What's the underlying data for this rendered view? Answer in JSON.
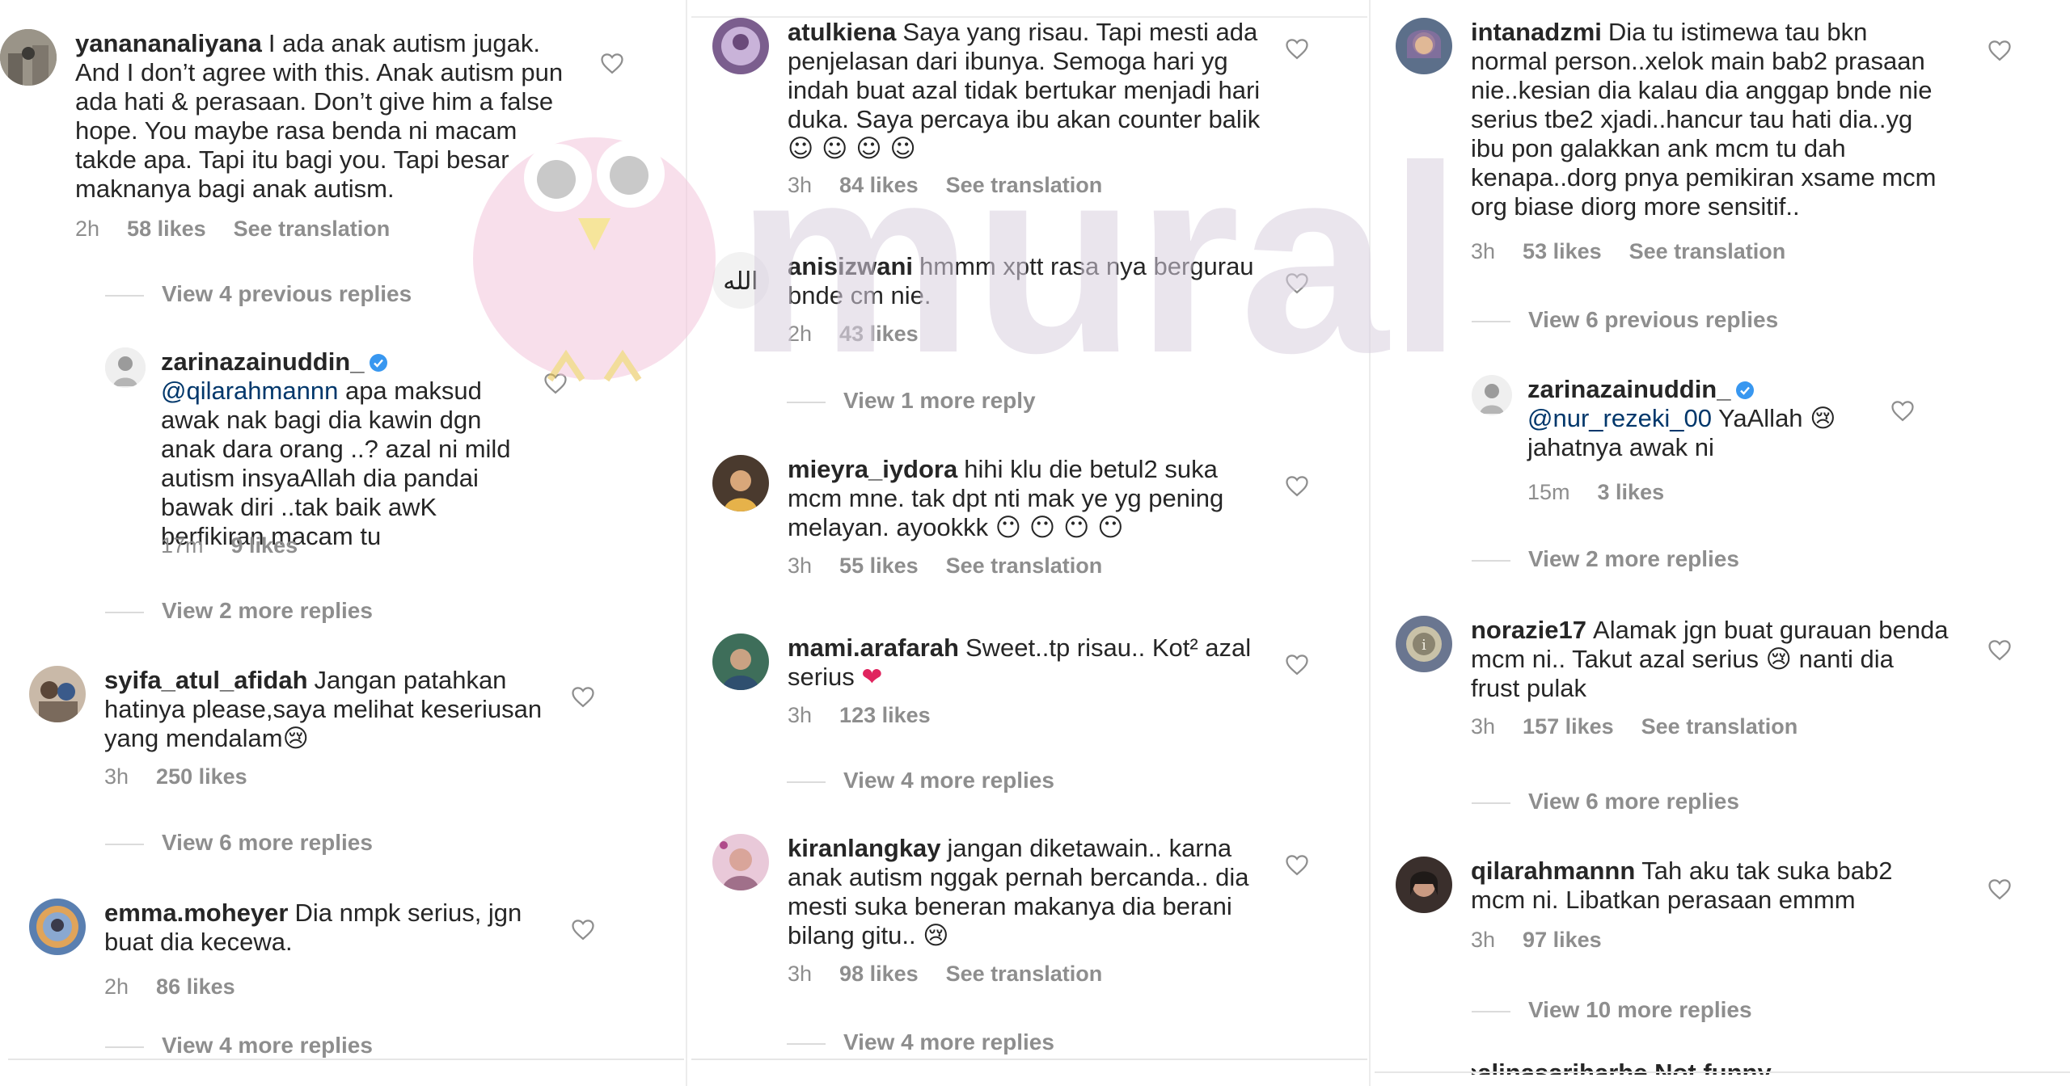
{
  "watermark": {
    "text": "mural"
  },
  "labels": {
    "see_translation": "See translation"
  },
  "columns": [
    {
      "items": [
        {
          "kind": "comment",
          "username": "yanananaliyana",
          "text": "I ada anak autism jugak. And I don’t agree with this. Anak autism pun ada hati & perasaan. Don’t give him a false hope. You maybe rasa benda ni macam takde apa. Tapi itu bagi you. Tapi besar maknanya bagi anak autism.",
          "time": "2h",
          "likes": "58 likes",
          "see_translation": true,
          "avatar": "#8a8478"
        },
        {
          "kind": "view",
          "text": "View 4 previous replies"
        },
        {
          "kind": "reply",
          "username": "zarinazainuddin_",
          "verified": true,
          "mention": "@qilarahmannn",
          "text": "apa maksud awak nak bagi dia kawin dgn anak dara orang ..? azal ni mild autism insyaAllah dia pandai bawak diri ..tak baik awK berfikiran macam tu",
          "time": "17m",
          "likes": "9 likes",
          "see_translation": false,
          "avatar": "#d9d9d9"
        },
        {
          "kind": "view",
          "text": "View 2 more replies"
        },
        {
          "kind": "comment",
          "username": "syifa_atul_afidah",
          "text": "Jangan patahkan hatinya please,saya melihat keseriusan yang mendalam",
          "emoji": "😢",
          "time": "3h",
          "likes": "250 likes",
          "see_translation": false,
          "avatar": "#7a6a5c"
        },
        {
          "kind": "view",
          "text": "View 6 more replies"
        },
        {
          "kind": "comment",
          "username": "emma.moheyer",
          "text": "Dia nmpk serius, jgn buat dia kecewa.",
          "time": "2h",
          "likes": "86 likes",
          "see_translation": false,
          "avatar": "#5a7fb0"
        },
        {
          "kind": "view",
          "text": "View 4 more replies"
        }
      ]
    },
    {
      "items": [
        {
          "kind": "comment",
          "username": "atulkiena",
          "text": "Saya yang risau. Tapi mesti ada penjelasan dari ibunya. Semoga hari yg indah buat azal tidak bertukar menjadi hari duka. Saya percaya ibu akan counter balik",
          "emoji": "☺ ☺ ☺ ☺",
          "time": "3h",
          "likes": "84 likes",
          "see_translation": true,
          "avatar": "#7b5e8e"
        },
        {
          "kind": "comment",
          "username": "anisizwani",
          "text": "hmmm xptt rasa nya bergurau bnde cm nie.",
          "time": "2h",
          "likes": "43 likes",
          "see_translation": false,
          "avatar": "#2b2b2b"
        },
        {
          "kind": "view",
          "text": "View 1 more reply"
        },
        {
          "kind": "comment",
          "username": "mieyra_iydora",
          "text": "hihi klu die betul2 suka mcm mne. tak dpt nti  mak ye yg pening melayan. ayookkk",
          "emoji": "😶 😶 😶 😶",
          "time": "3h",
          "likes": "55 likes",
          "see_translation": true,
          "avatar": "#4a3a2e"
        },
        {
          "kind": "comment",
          "username": "mami.arafarah",
          "text": "Sweet..tp risau.. Kot² azal serius",
          "emoji": "❤",
          "time": "3h",
          "likes": "123 likes",
          "see_translation": false,
          "avatar": "#3e6e5a"
        },
        {
          "kind": "view",
          "text": "View 4 more replies"
        },
        {
          "kind": "comment",
          "username": "kiranlangkay",
          "text": "jangan diketawain.. karna anak autism nggak pernah bercanda.. dia mesti suka beneran makanya dia berani bilang gitu..",
          "emoji": "😢",
          "time": "3h",
          "likes": "98 likes",
          "see_translation": true,
          "avatar": "#a0708a"
        },
        {
          "kind": "view",
          "text": "View 4 more replies"
        }
      ]
    },
    {
      "items": [
        {
          "kind": "comment",
          "username": "intanadzmi",
          "text": "Dia tu istimewa tau bkn normal person..xelok main bab2 prasaan nie..kesian dia kalau dia anggap bnde nie serius tbe2 xjadi..hancur tau hati dia..yg ibu pon galakkan ank mcm tu dah kenapa..dorg pnya pemikiran xsame mcm org biase diorg more sensitif..",
          "time": "3h",
          "likes": "53 likes",
          "see_translation": true,
          "avatar": "#5c6f8a"
        },
        {
          "kind": "view",
          "text": "View 6 previous replies"
        },
        {
          "kind": "reply",
          "username": "zarinazainuddin_",
          "verified": true,
          "mention": "@nur_rezeki_00",
          "text": "YaAllah",
          "emoji_after": "😢",
          "text2": "jahatnya awak ni",
          "time": "15m",
          "likes": "3 likes",
          "see_translation": false,
          "avatar": "#d9d9d9"
        },
        {
          "kind": "view",
          "text": "View 2 more replies"
        },
        {
          "kind": "comment",
          "username": "norazie17",
          "text": "Alamak jgn buat gurauan benda mcm ni.. Takut azal serius",
          "emoji_inline": "😢",
          "text_after": "nanti dia frust pulak",
          "time": "3h",
          "likes": "157 likes",
          "see_translation": true,
          "avatar": "#6a7690"
        },
        {
          "kind": "view",
          "text": "View 6 more replies"
        },
        {
          "kind": "comment",
          "username": "qilarahmannn",
          "text": "Tah aku tak suka bab2 mcm ni. Libatkan perasaan emmm",
          "time": "3h",
          "likes": "97 likes",
          "see_translation": false,
          "avatar": "#3a2f2c"
        },
        {
          "kind": "view",
          "text": "View 10 more replies"
        },
        {
          "kind": "cutoff",
          "text": "salinasariharhe Not funny"
        }
      ]
    }
  ]
}
